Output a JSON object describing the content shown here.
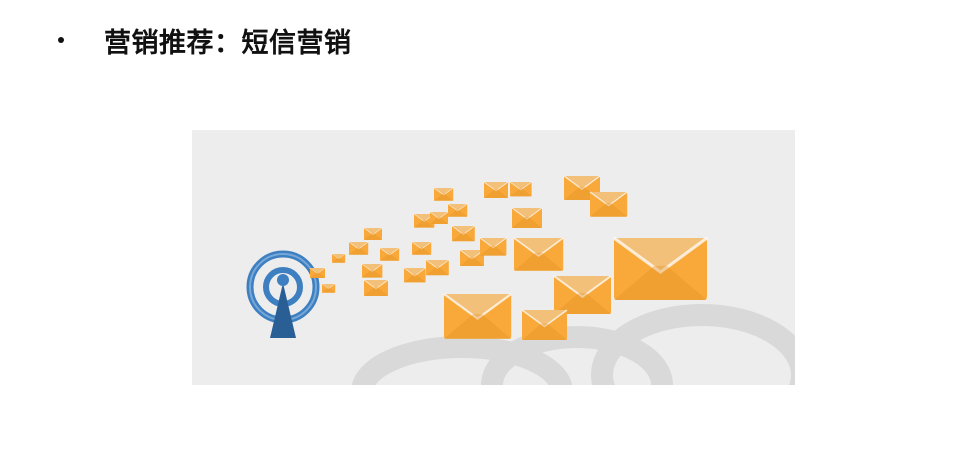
{
  "slide": {
    "bullet_title": "营销推荐：短信营销"
  },
  "illustration": {
    "subject": "sms-broadcast",
    "colors": {
      "background": "#ededed",
      "cloud": "#dcdcdc",
      "antenna_blue": "#3d7fc0",
      "antenna_dark": "#2a5f95",
      "envelope": "#f8a93a",
      "envelope_flap": "#f3c07a",
      "envelope_dark": "#e08f22"
    }
  }
}
